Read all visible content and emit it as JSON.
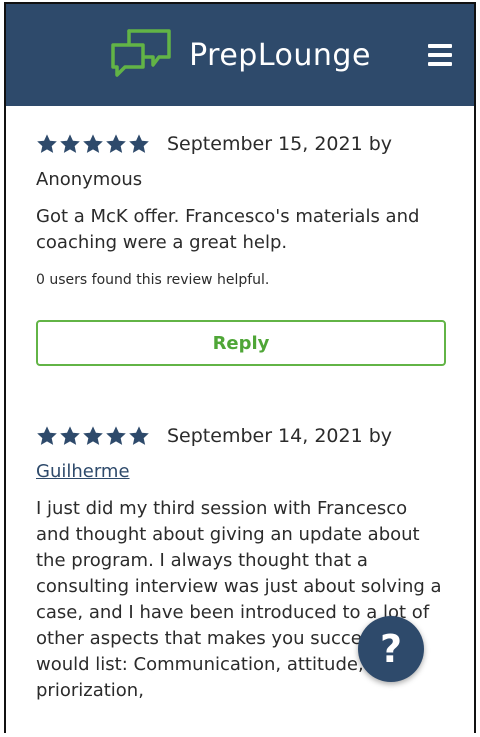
{
  "header": {
    "brand_name": "PrepLounge",
    "logo_icon": "chat-bubbles-icon",
    "menu_icon": "hamburger-menu-icon",
    "background_color": "#2e4a6b"
  },
  "reviews": [
    {
      "rating": 5,
      "date_text": "September 15, 2021 by",
      "author": "Anonymous",
      "text": "Got a McK offer. Francesco's materials and coaching were a great help.",
      "helpful_text": "0 users found this review helpful.",
      "reply_label": "Reply"
    },
    {
      "rating": 5,
      "date_text": "September 14, 2021 by",
      "author": "Guilherme",
      "text": "I just did my third session with Francesco and thought about giving an update about the program. I always thought that a consulting interview was just about solving a case, and I have been introduced to a lot of other aspects that makes you succeed. I would list: Communication, attitude, priorization,"
    }
  ],
  "help_button": {
    "label": "?",
    "icon": "question-mark-icon"
  },
  "colors": {
    "accent_green": "#62b446",
    "star_color": "#2e4a6b",
    "text_color": "#2b2b2b"
  }
}
